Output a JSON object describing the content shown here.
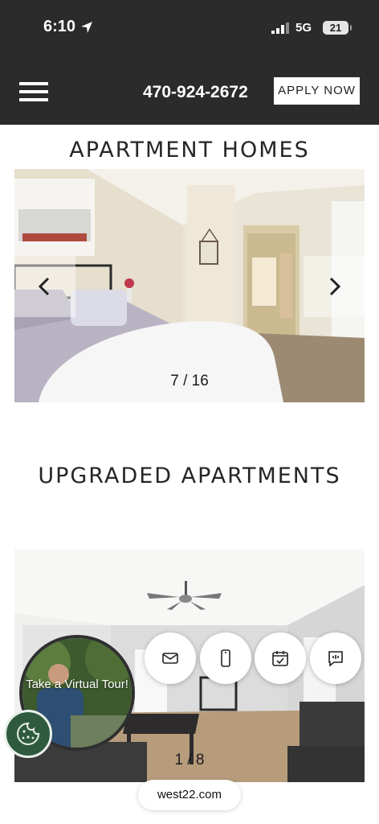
{
  "status_bar": {
    "time": "6:10",
    "network": "5G",
    "battery": "21"
  },
  "nav": {
    "phone": "470-924-2672",
    "apply_label": "APPLY NOW"
  },
  "section1": {
    "title": "APARTMENT HOMES",
    "counter": "7 / 16"
  },
  "section2": {
    "title": "UPGRADED APARTMENTS",
    "counter": "1 / 8"
  },
  "tour": {
    "label": "Take a Virtual Tour!"
  },
  "actions": [
    "mail-icon",
    "phone-icon",
    "calendar-icon",
    "chat-icon"
  ],
  "url": "west22.com",
  "colors": {
    "header_bg": "#2b2b2b",
    "cookie_bg": "#2f5a3e"
  }
}
